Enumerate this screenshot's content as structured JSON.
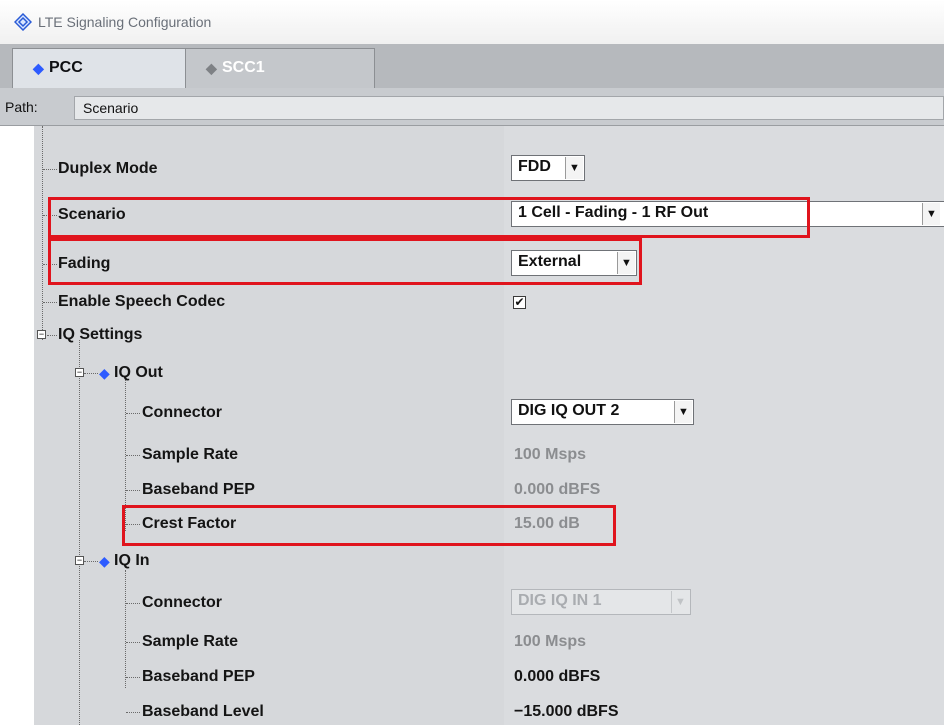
{
  "window": {
    "title": "LTE Signaling Configuration"
  },
  "tabs": [
    {
      "label": "PCC",
      "active": true
    },
    {
      "label": "SCC1",
      "active": false
    }
  ],
  "path": {
    "label": "Path:",
    "value": "Scenario"
  },
  "rows": {
    "duplex_mode": {
      "label": "Duplex Mode",
      "value": "FDD"
    },
    "scenario": {
      "label": "Scenario",
      "value": "1 Cell - Fading - 1 RF Out"
    },
    "fading": {
      "label": "Fading",
      "value": "External"
    },
    "speech_codec": {
      "label": "Enable Speech Codec",
      "checked": true,
      "check_glyph": "✔"
    },
    "iq_settings": {
      "label": "IQ Settings",
      "expander": "−"
    },
    "iq_out": {
      "label": "IQ Out",
      "expander": "−",
      "connector": {
        "label": "Connector",
        "value": "DIG IQ OUT 2"
      },
      "sample_rate": {
        "label": "Sample Rate",
        "value": "100 Msps"
      },
      "baseband_pep": {
        "label": "Baseband PEP",
        "value": "0.000 dBFS"
      },
      "crest_factor": {
        "label": "Crest Factor",
        "value": "15.00 dB"
      }
    },
    "iq_in": {
      "label": "IQ In",
      "expander": "−",
      "connector": {
        "label": "Connector",
        "value": "DIG IQ IN 1"
      },
      "sample_rate": {
        "label": "Sample Rate",
        "value": "100 Msps"
      },
      "baseband_pep": {
        "label": "Baseband PEP",
        "value": "0.000 dBFS"
      },
      "baseband_level": {
        "label": "Baseband Level",
        "value": "−15.000 dBFS"
      }
    }
  },
  "glyphs": {
    "dropdown_arrow": "▼",
    "tab_indicator": "◆",
    "node_indicator": "◆"
  },
  "colors": {
    "highlight_box": "#e0141d",
    "active_indicator": "#2d5bff",
    "tree_bg": "#d6d8db"
  }
}
